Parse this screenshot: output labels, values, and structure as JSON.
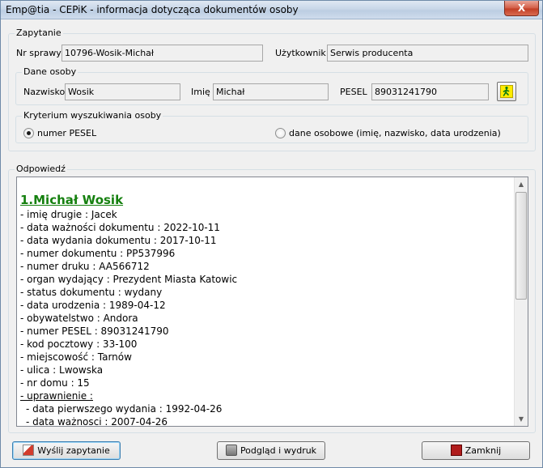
{
  "window": {
    "title": "Emp@tia - CEPiK - informacja dotycząca dokumentów osoby",
    "close_glyph": "X"
  },
  "query": {
    "legend": "Zapytanie",
    "case_label": "Nr sprawy",
    "case_value": "10796-Wosik-Michał",
    "user_label": "Użytkownik",
    "user_value": "Serwis producenta"
  },
  "person": {
    "legend": "Dane osoby",
    "surname_label": "Nazwisko",
    "surname_value": "Wosik",
    "name_label": "Imię",
    "name_value": "Michał",
    "pesel_label": "PESEL",
    "pesel_value": "89031241790",
    "lookup_icon": "running-person-icon"
  },
  "criteria": {
    "legend": "Kryterium wyszukiwania osoby",
    "option_pesel": "numer PESEL",
    "option_personal": "dane osobowe (imię, nazwisko, data urodzenia)",
    "selected": "pesel"
  },
  "response": {
    "legend": "Odpowiedź",
    "heading": "1.Michał Wosik",
    "lines": [
      "- imię drugie : Jacek",
      "- data ważności dokumentu : 2022-10-11",
      "- data wydania dokumentu : 2017-10-11",
      "- numer dokumentu : PP537996",
      "- numer druku : AA566712",
      "- organ wydający : Prezydent Miasta Katowic",
      "- status dokumentu : wydany",
      "- data urodzenia : 1989-04-12",
      "- obywatelstwo : Andora",
      "- numer PESEL : 89031241790",
      "- kod pocztowy : 33-100",
      "- miejscowość : Tarnów",
      "- ulica : Lwowska",
      "- nr domu : 15"
    ],
    "section": "- uprawnienie :",
    "sub_lines": [
      "- data pierwszego wydania : 1992-04-26",
      "- data ważnosci : 2007-04-26"
    ]
  },
  "buttons": {
    "send": "Wyślij zapytanie",
    "preview": "Podgląd i wydruk",
    "close": "Zamknij"
  },
  "colors": {
    "heading_green": "#15800f"
  }
}
